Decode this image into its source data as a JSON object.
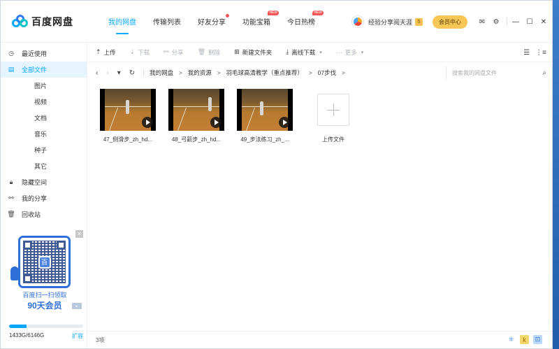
{
  "app": {
    "name": "百度网盘"
  },
  "nav": {
    "tabs": [
      {
        "label": "我的网盘"
      },
      {
        "label": "传输列表"
      },
      {
        "label": "好友分享"
      },
      {
        "label": "功能宝箱",
        "badge": "NEW"
      },
      {
        "label": "今日热榜",
        "badge": "NEW"
      }
    ]
  },
  "user": {
    "name": "经验分享阅天涯",
    "vip_level": "5",
    "member_center": "会员中心"
  },
  "sidebar": {
    "items": [
      {
        "label": "最近使用",
        "icon": "clock-icon"
      },
      {
        "label": "全部文件",
        "icon": "file-icon"
      },
      {
        "label": "图片"
      },
      {
        "label": "视频"
      },
      {
        "label": "文档"
      },
      {
        "label": "音乐"
      },
      {
        "label": "种子"
      },
      {
        "label": "其它"
      },
      {
        "label": "隐藏空间",
        "icon": "lock-icon"
      },
      {
        "label": "我的分享",
        "icon": "share-icon"
      },
      {
        "label": "回收站",
        "icon": "trash-icon"
      }
    ],
    "promo": {
      "line1": "百度扫一扫领取",
      "line2": "90天会员"
    },
    "quota": {
      "text": "1433G/6146G",
      "expand": "扩容",
      "used_fraction": 0.233
    }
  },
  "toolbar": {
    "upload": "上传",
    "download": "下载",
    "share": "分享",
    "delete": "删除",
    "new_folder": "新建文件夹",
    "offline_download": "离线下载",
    "more": "更多"
  },
  "path": {
    "crumbs": [
      "我的网盘",
      "我的资源",
      "羽毛球高清教学（重点推荐）",
      "07步伐"
    ],
    "search_placeholder": "搜索我的网盘文件"
  },
  "files": [
    {
      "name": "47_侧滑步_zh_hd..."
    },
    {
      "name": "48_弓箭步_zh_hd..."
    },
    {
      "name": "49_步法练习_zh_..."
    }
  ],
  "upload_card": {
    "label": "上传文件"
  },
  "status": {
    "count": "3项"
  },
  "colors": {
    "accent": "#06a7ff",
    "gold": "#f6c656",
    "promo_blue": "#2f6fd8"
  }
}
